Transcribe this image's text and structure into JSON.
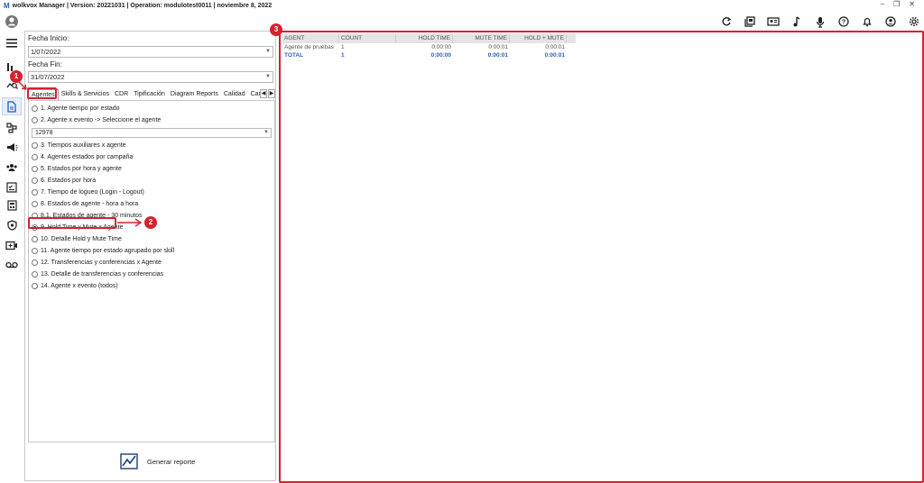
{
  "app": {
    "logo": "M",
    "title": "wolkvox Manager  | Version: 20221031  |  Operation: modulotest0011  |  noviembre 8, 2022"
  },
  "window_controls": {
    "minimize": "–",
    "restore": "❐",
    "close": "✕"
  },
  "toolbar_icons": [
    "refresh-icon",
    "book-icon",
    "id-card-icon",
    "music-note-icon",
    "microphone-icon",
    "help-icon",
    "bell-icon",
    "user-circle-icon",
    "settings-icon"
  ],
  "left_rail_icons": [
    "user-avatar-icon",
    "menu-icon",
    "bar-chart-icon",
    "search-graph-icon",
    "reports-icon",
    "flow-icon",
    "campaign-icon",
    "team-icon",
    "checklist-icon",
    "calculator-icon",
    "shield-icon",
    "video-icon",
    "voicemail-icon"
  ],
  "filters": {
    "start_label": "Fecha Inicio:",
    "start_value": "1/07/2022",
    "end_label": "Fecha Fin:",
    "end_value": "31/07/2022"
  },
  "tabs": [
    "Agentes",
    "Skills & Servicios",
    "CDR",
    "Tipificación",
    "Diagram Reports",
    "Calidad",
    "Cam"
  ],
  "agent_select_value": "12978",
  "options": [
    "1. Agente tiempo por estado",
    "2. Agente x evento -> Seleccione el agente",
    "3. Tiempos auxiliares x agente",
    "4. Agentes estados por campaña",
    "5. Estados por hora y agente",
    "6. Estados por hora",
    "7. Tiempo de logueo (Login - Logout)",
    "8. Estados de agente - hora a hora",
    "8.1. Estados de agente - 30 minutos",
    "9. Hold Time y Mute x Agente",
    "10. Detalle Hold y Mute Time",
    "11. Agente tiempo por estado agrupado por skill",
    "12. Transferencias y conferencias x Agente",
    "13. Detalle de transferencias y conferencias",
    "14. Agente x evento (todos)"
  ],
  "selected_option": "9. Hold Time y Mute x Agente",
  "generate_label": "Generar reporte",
  "badges": [
    "1",
    "2",
    "3"
  ],
  "table": {
    "headers": [
      "AGENT",
      "COUNT",
      "HOLD TIME",
      "MUTE TIME",
      "HOLD + MUTE"
    ],
    "rows": [
      [
        "Agente de pruebas",
        "1",
        "0:00:00",
        "0:00:01",
        "0:00:01"
      ]
    ],
    "total": [
      "TOTAL",
      "1",
      "0:00:00",
      "0:00:01",
      "0:00:01"
    ]
  },
  "colors": {
    "accent": "#d6212f",
    "total_text": "#2f5fb0",
    "header_bg": "#e4e4e4"
  }
}
